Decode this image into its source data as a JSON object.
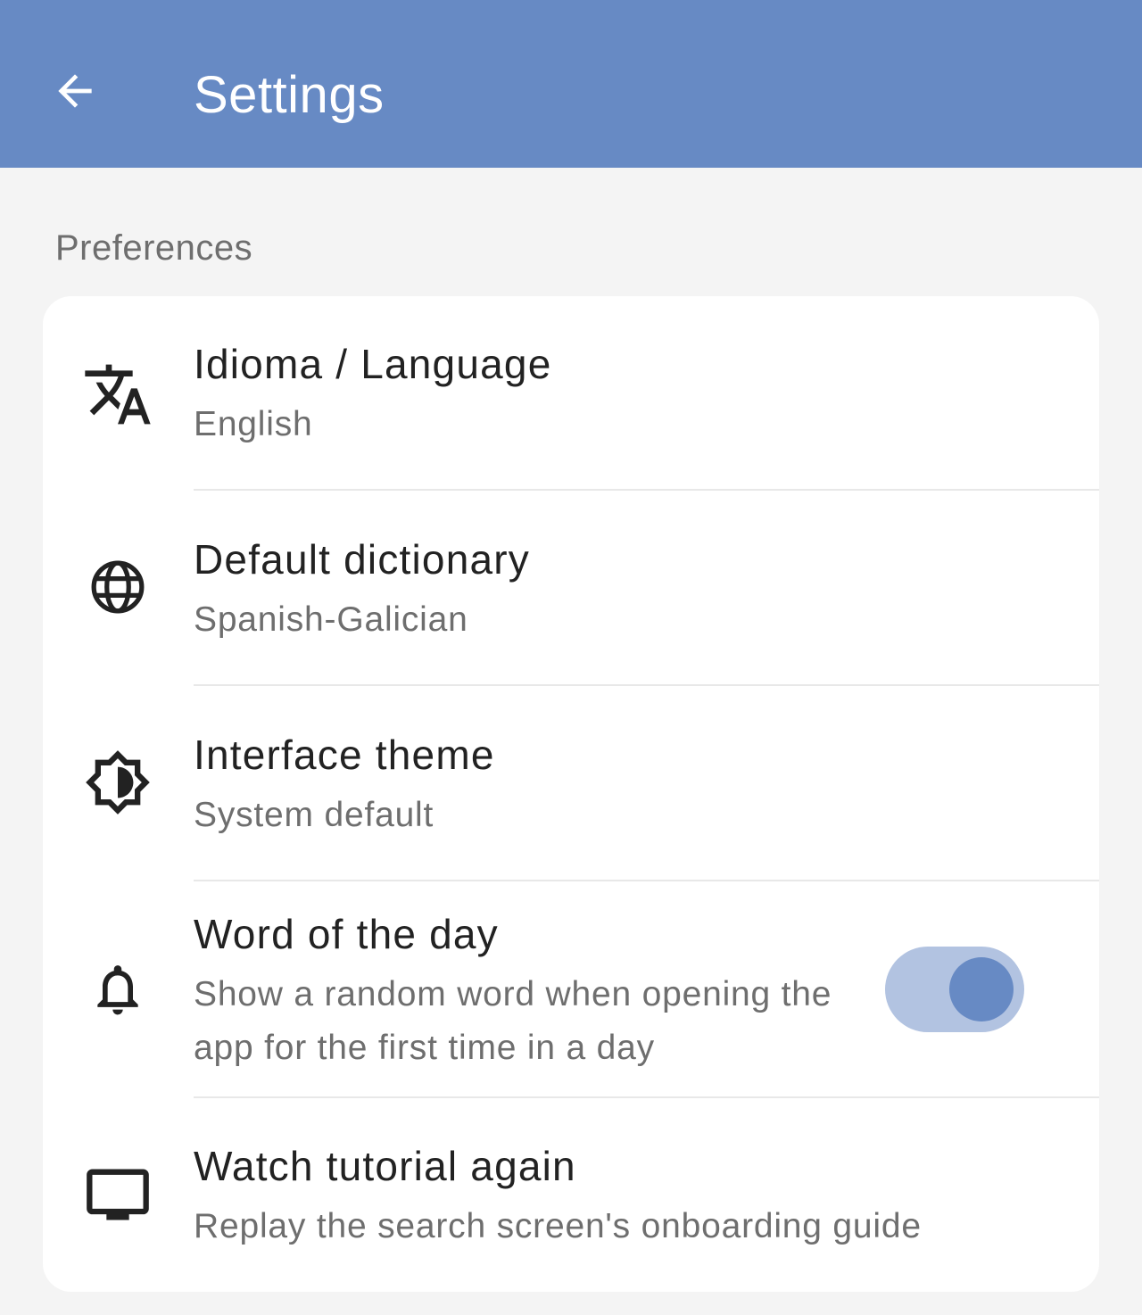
{
  "appbar": {
    "title": "Settings",
    "back_icon": "arrow-back-icon",
    "color": "#678ac4"
  },
  "section": {
    "title": "Preferences"
  },
  "settings": [
    {
      "title": "Idioma / Language",
      "subtitle": "English",
      "icon": "translate-icon"
    },
    {
      "title": "Default dictionary",
      "subtitle": "Spanish-Galician",
      "icon": "globe-icon"
    },
    {
      "title": "Interface theme",
      "subtitle": "System default",
      "icon": "brightness-icon"
    },
    {
      "title": "Word of the day",
      "subtitle": "Show a random word when opening the app for the first time in a day",
      "icon": "bell-icon",
      "toggle_on": true
    },
    {
      "title": "Watch tutorial again",
      "subtitle": "Replay the search screen's onboarding guide",
      "icon": "monitor-icon"
    }
  ]
}
